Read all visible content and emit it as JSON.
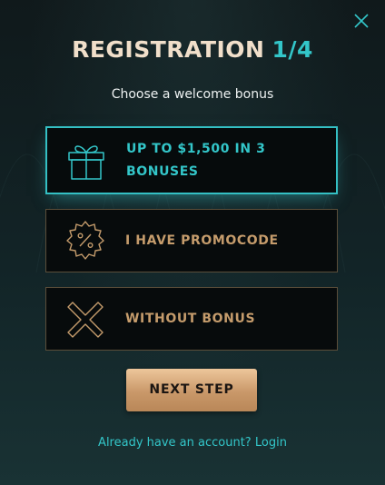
{
  "dialog": {
    "title": "REGISTRATION",
    "step": "1/4",
    "subtitle": "Choose a welcome bonus"
  },
  "options": [
    {
      "label": "UP TO $1,500 IN 3 BONUSES",
      "icon": "gift-icon",
      "selected": true
    },
    {
      "label": "I HAVE PROMOCODE",
      "icon": "percent-badge-icon",
      "selected": false
    },
    {
      "label": "WITHOUT BONUS",
      "icon": "cross-icon",
      "selected": false
    }
  ],
  "actions": {
    "next_label": "NEXT STEP",
    "login_prompt": "Already have an account?",
    "login_link": "Login"
  },
  "colors": {
    "accent_teal": "#33c6c9",
    "accent_gold": "#c59c6c",
    "title_text": "#f1dfca",
    "background": "#122427"
  }
}
